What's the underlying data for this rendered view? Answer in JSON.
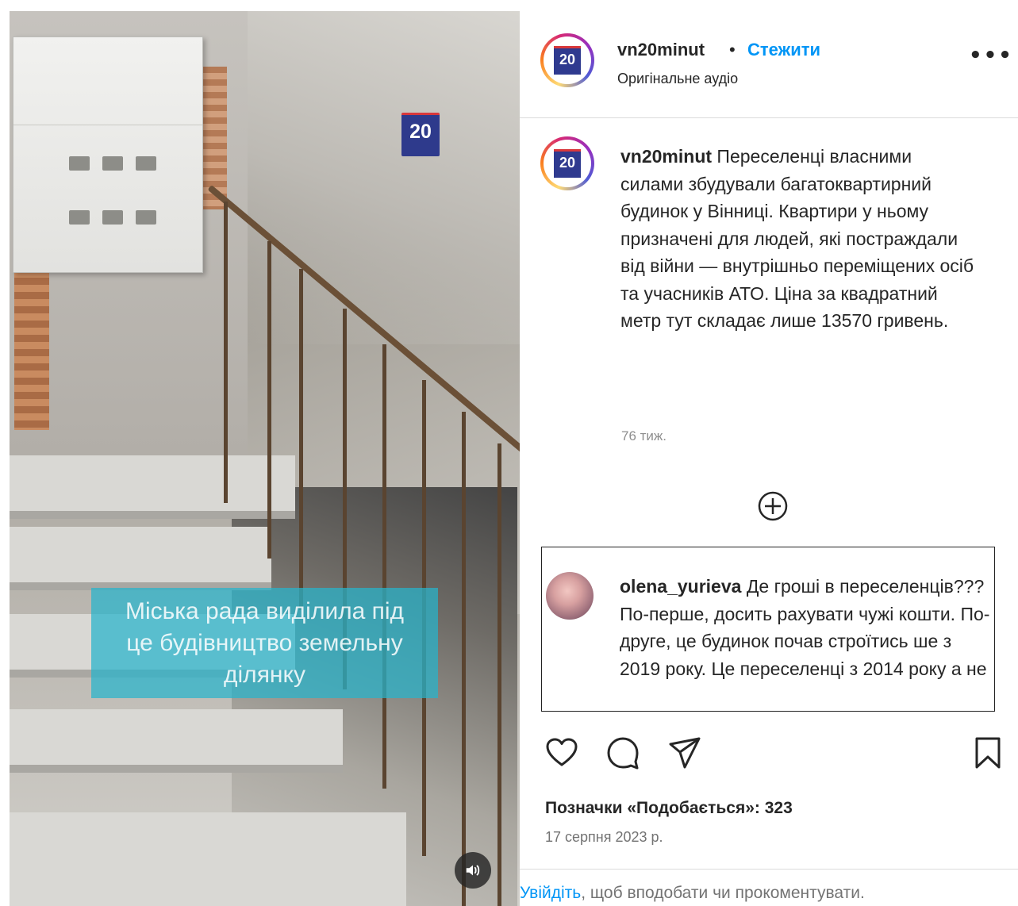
{
  "media": {
    "logo_text": "20",
    "caption_lines": [
      "Міська рада виділила під",
      "це будівництво земельну",
      "ділянку"
    ],
    "sound_icon": "speaker-icon"
  },
  "header": {
    "logo_text": "20",
    "username": "vn20minut",
    "separator": "•",
    "follow_label": "Стежити",
    "audio_label": "Оригінальне аудіо",
    "more_icon": "•••"
  },
  "post_caption": {
    "logo_text": "20",
    "username": "vn20minut",
    "text": "Переселенці власними силами збудували багатоквартирний будинок у Вінниці. Квартири у ньому призначені для людей, які постраждали від війни — внутрішньо переміщених осіб та учасників АТО. Ціна за квадратний метр тут складає лише 13570 гривень.",
    "time_ago": "76 тиж."
  },
  "comment": {
    "username": "olena_yurieva",
    "text": "Де гроші в переселенців??? По-перше, досить рахувати чужі кошти. По-друге, це будинок почав строїтись ше з 2019 року. Це переселенці з 2014 року а не"
  },
  "actions": {
    "icons": [
      "heart-icon",
      "comment-icon",
      "share-icon",
      "bookmark-icon"
    ]
  },
  "likes_label": "Позначки «Подобається»: 323",
  "likes_count": 323,
  "date": "17 серпня 2023 р.",
  "login_prompt": {
    "link": "Увійдіть",
    "rest": ", щоб вподобати чи прокоментувати."
  },
  "colors": {
    "accent_blue": "#0095f6",
    "caption_overlay": "#27b4cc",
    "brand_logo": "#2f3a8f",
    "brand_red": "#d8383c"
  }
}
